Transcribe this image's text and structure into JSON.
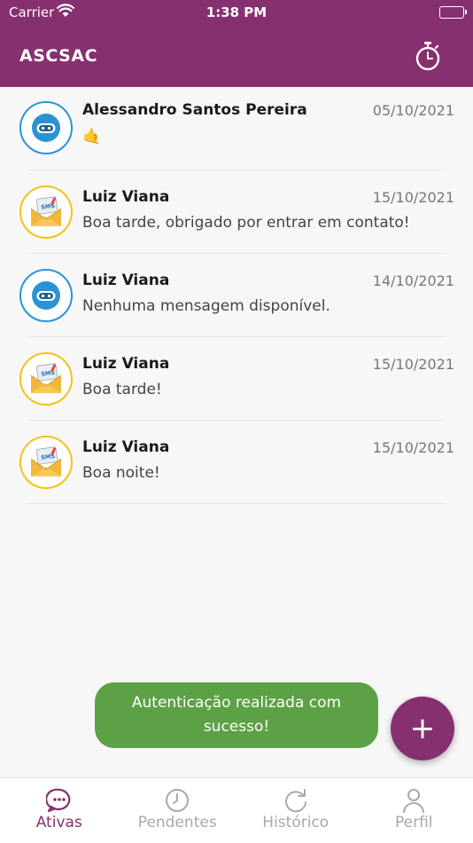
{
  "status_bar": {
    "carrier": "Carrier",
    "time": "1:38 PM"
  },
  "header": {
    "title": "ASCSAC",
    "timer_icon": "stopwatch-icon"
  },
  "colors": {
    "brand": "#863070",
    "bot": "#2a93d5",
    "sms": "#f0c419",
    "toast": "#5da146"
  },
  "conversations": [
    {
      "name": "Alessandro Santos Pereira",
      "date": "05/10/2021",
      "message": "🤙",
      "channel": "bot",
      "avatar_icon": "bot-icon"
    },
    {
      "name": "Luiz Viana",
      "date": "15/10/2021",
      "message": "Boa tarde, obrigado por entrar em contato!",
      "channel": "sms",
      "avatar_icon": "sms-envelope-icon"
    },
    {
      "name": "Luiz Viana",
      "date": "14/10/2021",
      "message": "Nenhuma mensagem disponível.",
      "channel": "bot",
      "avatar_icon": "bot-icon"
    },
    {
      "name": "Luiz Viana",
      "date": "15/10/2021",
      "message": "Boa tarde!",
      "channel": "sms",
      "avatar_icon": "sms-envelope-icon"
    },
    {
      "name": "Luiz Viana",
      "date": "15/10/2021",
      "message": "Boa noite!",
      "channel": "sms",
      "avatar_icon": "sms-envelope-icon"
    }
  ],
  "sms_label": "SMS",
  "toast": {
    "message": "Autenticação realizada com sucesso!"
  },
  "fab": {
    "label": "+"
  },
  "tabs": [
    {
      "label": "Ativas",
      "icon": "chat-bubble-icon",
      "active": true
    },
    {
      "label": "Pendentes",
      "icon": "clock-icon",
      "active": false
    },
    {
      "label": "Histórico",
      "icon": "refresh-icon",
      "active": false
    },
    {
      "label": "Perfil",
      "icon": "person-icon",
      "active": false
    }
  ]
}
